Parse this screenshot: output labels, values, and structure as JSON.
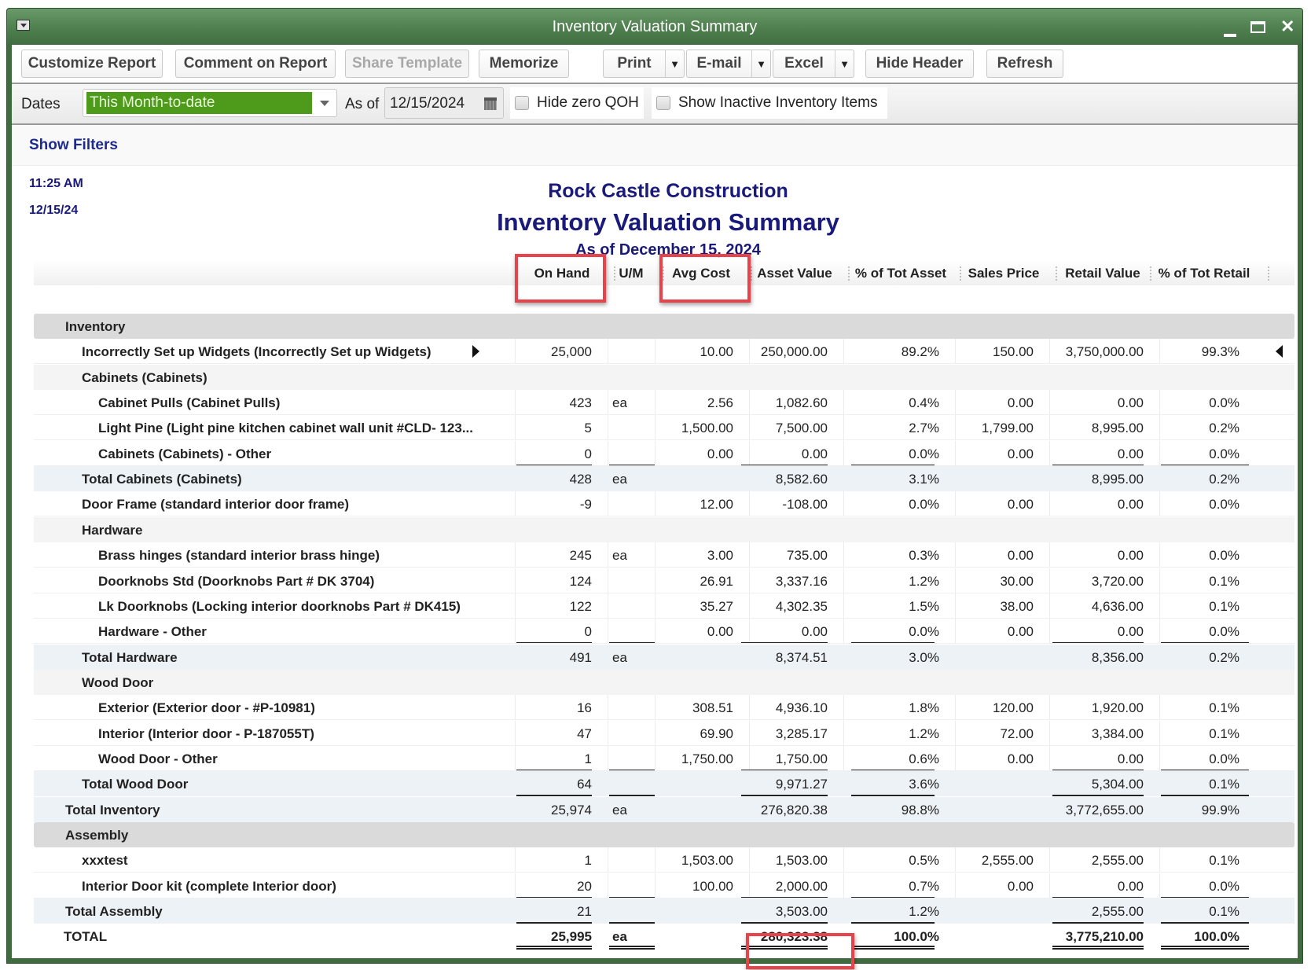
{
  "window": {
    "title": "Inventory Valuation Summary",
    "controls": [
      "minimize",
      "maximize",
      "close"
    ]
  },
  "toolbar": {
    "customize_label": "Customize Report",
    "comment_label": "Comment on Report",
    "share_label": "Share Template",
    "memorize_label": "Memorize",
    "print_label": "Print",
    "email_label": "E-mail",
    "excel_label": "Excel",
    "hide_header_label": "Hide Header",
    "refresh_label": "Refresh"
  },
  "options": {
    "dates_label": "Dates",
    "dates_value": "This Month-to-date",
    "asof_label": "As of",
    "asof_value": "12/15/2024",
    "hide_zero_label": "Hide zero QOH",
    "hide_zero_checked": false,
    "show_inactive_label": "Show Inactive Inventory Items",
    "show_inactive_checked": false
  },
  "filters": {
    "show_filters_label": "Show Filters"
  },
  "report": {
    "time": "11:25 AM",
    "date": "12/15/24",
    "company": "Rock Castle Construction",
    "title": "Inventory Valuation Summary",
    "subtitle": "As of December 15, 2024",
    "columns": [
      "On Hand",
      "U/M",
      "Avg Cost",
      "Asset Value",
      "% of Tot Asset",
      "Sales Price",
      "Retail Value",
      "% of Tot Retail"
    ],
    "highlighted": [
      "On Hand",
      "Avg Cost",
      "TOTAL Asset Value"
    ],
    "rows": [
      {
        "type": "section",
        "indent": 0,
        "label": "Inventory",
        "cells": [
          "",
          "",
          "",
          "",
          "",
          "",
          "",
          ""
        ]
      },
      {
        "type": "item",
        "indent": 1,
        "label": "Incorrectly Set up Widgets (Incorrectly Set up Widgets)",
        "cells": [
          "25,000",
          "",
          "10.00",
          "250,000.00",
          "89.2%",
          "150.00",
          "3,750,000.00",
          "99.3%"
        ],
        "selected": true
      },
      {
        "type": "group",
        "indent": 1,
        "label": "Cabinets (Cabinets)",
        "cells": [
          "",
          "",
          "",
          "",
          "",
          "",
          "",
          ""
        ]
      },
      {
        "type": "item",
        "indent": 2,
        "label": "Cabinet Pulls (Cabinet Pulls)",
        "cells": [
          "423",
          "ea",
          "2.56",
          "1,082.60",
          "0.4%",
          "0.00",
          "0.00",
          "0.0%"
        ]
      },
      {
        "type": "item",
        "indent": 2,
        "label": "Light Pine (Light pine kitchen cabinet wall unit  #CLD- 123...",
        "cells": [
          "5",
          "",
          "1,500.00",
          "7,500.00",
          "2.7%",
          "1,799.00",
          "8,995.00",
          "0.2%"
        ]
      },
      {
        "type": "item",
        "indent": 2,
        "label": "Cabinets (Cabinets) - Other",
        "cells": [
          "0",
          "",
          "0.00",
          "0.00",
          "0.0%",
          "0.00",
          "0.00",
          "0.0%"
        ],
        "underline": true
      },
      {
        "type": "total",
        "indent": 1,
        "label": "Total Cabinets (Cabinets)",
        "cells": [
          "428",
          "ea",
          "",
          "8,582.60",
          "3.1%",
          "",
          "8,995.00",
          "0.2%"
        ]
      },
      {
        "type": "item",
        "indent": 1,
        "label": "Door Frame (standard interior door frame)",
        "cells": [
          "-9",
          "",
          "12.00",
          "-108.00",
          "0.0%",
          "0.00",
          "0.00",
          "0.0%"
        ]
      },
      {
        "type": "group",
        "indent": 1,
        "label": "Hardware",
        "cells": [
          "",
          "",
          "",
          "",
          "",
          "",
          "",
          ""
        ]
      },
      {
        "type": "item",
        "indent": 2,
        "label": "Brass hinges (standard interior brass hinge)",
        "cells": [
          "245",
          "ea",
          "3.00",
          "735.00",
          "0.3%",
          "0.00",
          "0.00",
          "0.0%"
        ]
      },
      {
        "type": "item",
        "indent": 2,
        "label": "Doorknobs Std (Doorknobs Part # DK 3704)",
        "cells": [
          "124",
          "",
          "26.91",
          "3,337.16",
          "1.2%",
          "30.00",
          "3,720.00",
          "0.1%"
        ]
      },
      {
        "type": "item",
        "indent": 2,
        "label": "Lk Doorknobs (Locking interior doorknobs  Part # DK415)",
        "cells": [
          "122",
          "",
          "35.27",
          "4,302.35",
          "1.5%",
          "38.00",
          "4,636.00",
          "0.1%"
        ]
      },
      {
        "type": "item",
        "indent": 2,
        "label": "Hardware - Other",
        "cells": [
          "0",
          "",
          "0.00",
          "0.00",
          "0.0%",
          "0.00",
          "0.00",
          "0.0%"
        ],
        "underline": true
      },
      {
        "type": "total",
        "indent": 1,
        "label": "Total Hardware",
        "cells": [
          "491",
          "ea",
          "",
          "8,374.51",
          "3.0%",
          "",
          "8,356.00",
          "0.2%"
        ]
      },
      {
        "type": "group",
        "indent": 1,
        "label": "Wood Door",
        "cells": [
          "",
          "",
          "",
          "",
          "",
          "",
          "",
          ""
        ]
      },
      {
        "type": "item",
        "indent": 2,
        "label": "Exterior (Exterior door - #P-10981)",
        "cells": [
          "16",
          "",
          "308.51",
          "4,936.10",
          "1.8%",
          "120.00",
          "1,920.00",
          "0.1%"
        ]
      },
      {
        "type": "item",
        "indent": 2,
        "label": "Interior (Interior door - P-187055T)",
        "cells": [
          "47",
          "",
          "69.90",
          "3,285.17",
          "1.2%",
          "72.00",
          "3,384.00",
          "0.1%"
        ]
      },
      {
        "type": "item",
        "indent": 2,
        "label": "Wood Door - Other",
        "cells": [
          "1",
          "",
          "1,750.00",
          "1,750.00",
          "0.6%",
          "0.00",
          "0.00",
          "0.0%"
        ],
        "underline": true
      },
      {
        "type": "total",
        "indent": 1,
        "label": "Total Wood Door",
        "cells": [
          "64",
          "",
          "",
          "9,971.27",
          "3.6%",
          "",
          "5,304.00",
          "0.1%"
        ],
        "underline": true
      },
      {
        "type": "total",
        "indent": 0,
        "label": "Total Inventory",
        "cells": [
          "25,974",
          "ea",
          "",
          "276,820.38",
          "98.8%",
          "",
          "3,772,655.00",
          "99.9%"
        ]
      },
      {
        "type": "section",
        "indent": 0,
        "label": "Assembly",
        "cells": [
          "",
          "",
          "",
          "",
          "",
          "",
          "",
          ""
        ]
      },
      {
        "type": "item",
        "indent": 1,
        "label": "xxxtest",
        "cells": [
          "1",
          "",
          "1,503.00",
          "1,503.00",
          "0.5%",
          "2,555.00",
          "2,555.00",
          "0.1%"
        ]
      },
      {
        "type": "item",
        "indent": 1,
        "label": "Interior Door kit (complete Interior door)",
        "cells": [
          "20",
          "",
          "100.00",
          "2,000.00",
          "0.7%",
          "0.00",
          "0.00",
          "0.0%"
        ],
        "underline": true
      },
      {
        "type": "total",
        "indent": 0,
        "label": "Total Assembly",
        "cells": [
          "21",
          "",
          "",
          "3,503.00",
          "1.2%",
          "",
          "2,555.00",
          "0.1%"
        ],
        "underline": true
      },
      {
        "type": "grand",
        "indent": 0,
        "label": "TOTAL",
        "cells": [
          "25,995",
          "ea",
          "",
          "280,323.38",
          "100.0%",
          "",
          "3,775,210.00",
          "100.0%"
        ],
        "double": true
      }
    ]
  },
  "colors": {
    "title_bar": "#4f7f4f",
    "dates_selected_bg": "#4e9a1a",
    "report_heading": "#1a1a7a",
    "highlight_box": "#e8424a"
  }
}
